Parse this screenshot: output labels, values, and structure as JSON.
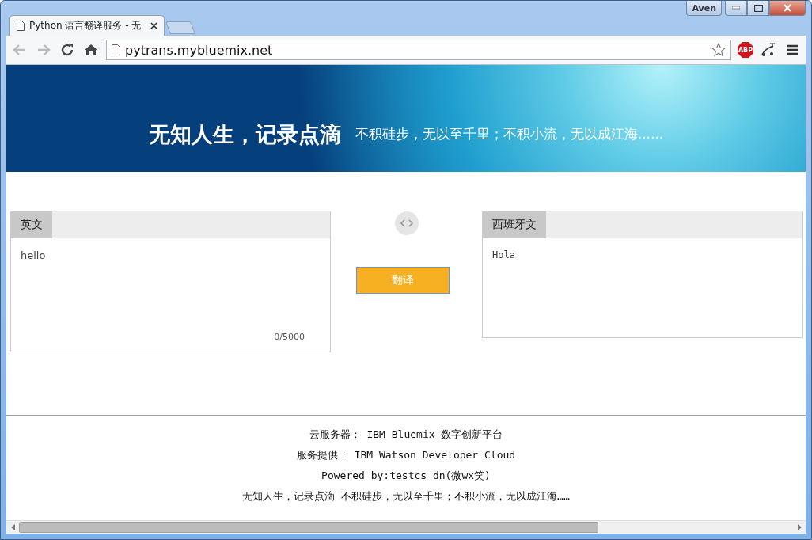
{
  "window": {
    "user": "Aven"
  },
  "tabs": [
    {
      "title": "Python 语言翻译服务 - 无",
      "selected": true
    }
  ],
  "address_bar": {
    "url": "pytrans.mybluemix.net"
  },
  "extensions": [
    {
      "kind": "abp",
      "label": "ABP"
    }
  ],
  "banner": {
    "title": "无知人生，记录点滴",
    "subtitle": "不积硅步，无以至千里；不积小流，无以成江海......"
  },
  "source": {
    "language": "英文",
    "text": "hello",
    "counter": "0/5000"
  },
  "target": {
    "language": "西班牙文",
    "text": "Hola"
  },
  "translate_button": "翻译",
  "footer": [
    "云服务器： IBM Bluemix 数字创新平台",
    "服务提供： IBM Watson Developer Cloud",
    "Powered by:testcs_dn(微wx笑)",
    "无知人生，记录点滴 不积硅步，无以至千里；不积小流，无以成江海……"
  ]
}
